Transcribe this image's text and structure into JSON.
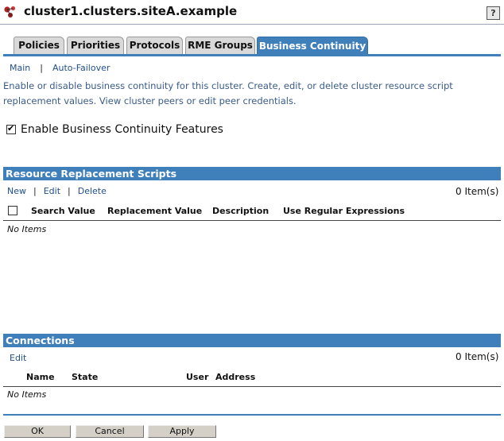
{
  "window": {
    "title": "cluster1.clusters.siteA.example",
    "help_label": "?"
  },
  "tabs": [
    {
      "label": "Policies",
      "active": false
    },
    {
      "label": "Priorities",
      "active": false
    },
    {
      "label": "Protocols",
      "active": false
    },
    {
      "label": "RME Groups",
      "active": false
    },
    {
      "label": "Business Continuity",
      "active": true
    }
  ],
  "subnav": {
    "items": [
      "Main",
      "Auto-Failover"
    ],
    "separator": "|"
  },
  "description": "Enable or disable business continuity for this cluster. Create, edit, or delete cluster resource script replacement values. View cluster peers or edit peer credentials.",
  "enable_checkbox": {
    "label": "Enable Business Continuity Features",
    "checked": true
  },
  "scripts_section": {
    "title": "Resource Replacement Scripts",
    "actions": [
      "New",
      "Edit",
      "Delete"
    ],
    "separator": "|",
    "count": "0 Item(s)",
    "columns": [
      "Search Value",
      "Replacement Value",
      "Description",
      "Use Regular Expressions"
    ],
    "empty_text": "No Items"
  },
  "connections_section": {
    "title": "Connections",
    "actions": [
      "Edit"
    ],
    "count": "0 Item(s)",
    "columns": [
      "Name",
      "State",
      "User",
      "Address"
    ],
    "empty_text": "No Items"
  },
  "buttons": {
    "ok": "OK",
    "cancel": "Cancel",
    "apply": "Apply"
  },
  "colors": {
    "accent": "#3f7fba",
    "link": "#1f4f8a",
    "description_text": "#3a5c8a",
    "tab_inactive": "#d9d9d9",
    "button_face": "#d4d0c8"
  },
  "icons": {
    "title_icon": "cluster-icon",
    "help_icon": "help-icon",
    "checkbox": "checkbox-checked"
  }
}
